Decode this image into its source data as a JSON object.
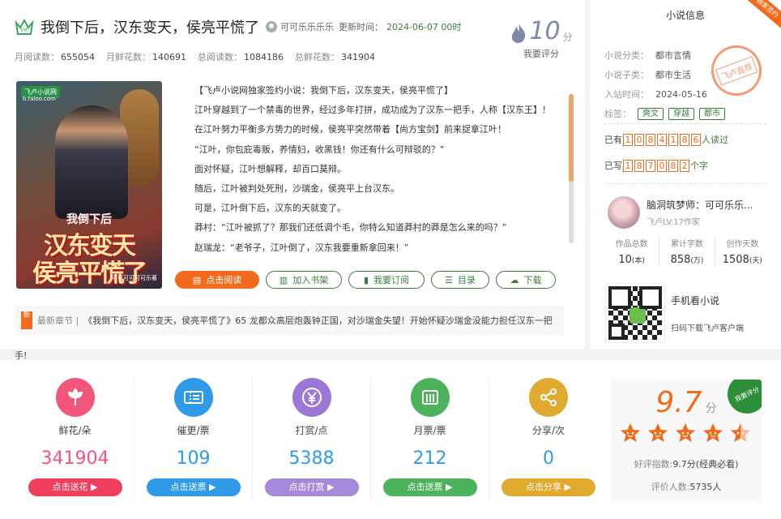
{
  "book": {
    "title": "我倒下后，汉东变天，侯亮平慌了",
    "author": "可可乐乐乐乐",
    "update_label": "更新时间：",
    "update_time": "2024-06-07 00时"
  },
  "stats": [
    {
      "label": "月阅读数：",
      "value": "655054"
    },
    {
      "label": "月鲜花数：",
      "value": "140691"
    },
    {
      "label": "总阅读数：",
      "value": "1084186"
    },
    {
      "label": "总鲜花数：",
      "value": "341904"
    }
  ],
  "score": {
    "value": "10",
    "unit": "分",
    "label": "我要评分"
  },
  "cover": {
    "publisher": "飞卢小说网",
    "url": "b.faloo.com",
    "line1": "我倒下后",
    "line2": "汉东变天",
    "line3": "侯亮平慌了",
    "author_mark": "可可可可可可乐著"
  },
  "intro": [
    "【飞卢小说网独家签约小说：我倒下后，汉东变天，侯亮平慌了】",
    "江叶穿越到了一个禁毒的世界，经过多年打拼，成功成为了汉东一把手，人称【汉东王】！",
    "在江叶努力平衡多方势力的时候，侯亮平突然带着【尚方宝剑】前来捉拿江叶！",
    "“江叶，你包庇毒贩，养情妇，收黑钱！你还有什么可辩驳的？”",
    "面对怀疑，江叶想解释，却百口莫辩。",
    "随后，江叶被判处死刑，沙瑞金，侯亮平上台汉东。",
    "可是，江叶倒下后，汉东的天就变了。",
    "莽村：“江叶被抓了？那我们还低调个毛，你特么知道莽村的莽是怎么来的吗？”",
    "赵瑞龙：“老爷子，江叶倒了，汉东我要重新拿回来！”"
  ],
  "buttons": {
    "read": "点击阅读",
    "shelf": "加入书架",
    "subscribe": "我要订阅",
    "catalog": "目录",
    "download": "下载"
  },
  "latest": {
    "badge": "新",
    "label": "最新章节 |",
    "text": "《我倒下后，汉东变天，侯亮平慌了》65 龙都众高层炮轰钟正国，对沙瑞金失望！开始怀疑沙瑞金没能力担任汉东一把",
    "tail": "手!"
  },
  "info": {
    "title": "小说信息",
    "ribbon": "独家签约",
    "category_label": "小说分类：",
    "category": "都市言情",
    "subcategory_label": "小说子类：",
    "subcategory": "都市生活",
    "date_label": "入站时间：",
    "date": "2024-05-16",
    "tags_label": "标签：",
    "tags": [
      "爽文",
      "穿越",
      "都市"
    ],
    "stamp": "飞卢直荐",
    "read_prefix": "已有",
    "read_digits": [
      "1",
      "0",
      "8",
      "4",
      "1",
      "8",
      "6"
    ],
    "read_suffix": "人读过",
    "write_prefix": "已写",
    "write_digits": [
      "1",
      "8",
      "7",
      "0",
      "8",
      "2"
    ],
    "write_suffix": "个字"
  },
  "author_card": {
    "name": "脑洞筑梦师：可可乐乐...",
    "level": "飞卢LV.17作家",
    "stats": [
      {
        "label": "作品总数",
        "value": "10",
        "unit": "(本)"
      },
      {
        "label": "累计字数",
        "value": "858",
        "unit": "(万)"
      },
      {
        "label": "创作天数",
        "value": "1508",
        "unit": "(天)"
      }
    ]
  },
  "mobile": {
    "title": "手机看小说",
    "subtitle": "扫码下载飞卢客户端"
  },
  "actions": [
    {
      "label": "鲜花/朵",
      "value": "341904",
      "button": "点击送花 ▶",
      "color": "#f2567a",
      "icon": "flower-icon"
    },
    {
      "label": "催更/票",
      "value": "109",
      "button": "点击送票 ▶",
      "color": "#2f9be8",
      "icon": "ticket-icon"
    },
    {
      "label": "打赏/点",
      "value": "5388",
      "button": "点击打赏 ▶",
      "color": "#9c77d6",
      "icon": "yuan-icon"
    },
    {
      "label": "月票/票",
      "value": "212",
      "button": "点击送票 ▶",
      "color": "#4cb35b",
      "icon": "monthly-ticket-icon"
    },
    {
      "label": "分享/次",
      "value": "0",
      "button": "点击分享 ▶",
      "color": "#e0aa2e",
      "icon": "share-icon"
    }
  ],
  "rating": {
    "score": "9.7",
    "unit": "分",
    "corner": "我要评分",
    "index_label": "好评指数:",
    "index_value": "9.7分(经典必看)",
    "count_label": "评价人数:",
    "count_value": "5735人",
    "stars": 4.5
  },
  "colors": {
    "accent": "#f26a1b",
    "green": "#3d7c3d"
  }
}
